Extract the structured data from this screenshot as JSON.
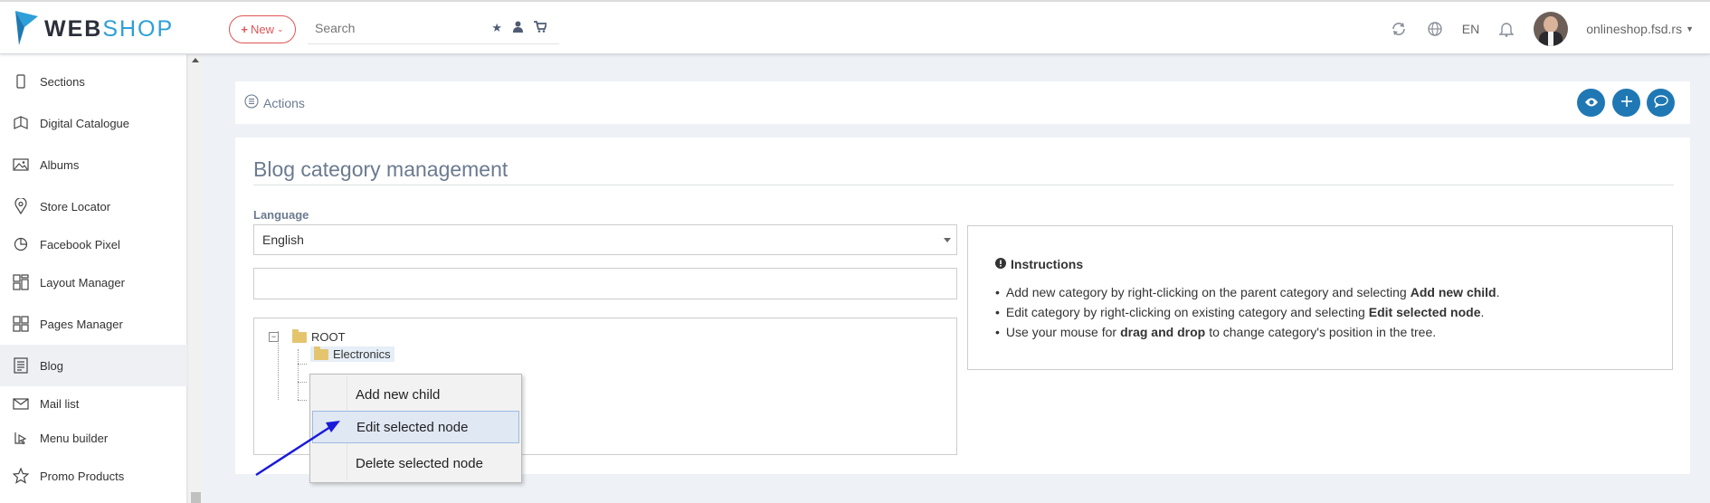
{
  "header": {
    "logo_web": "WEB",
    "logo_shop": "SHOP",
    "new_label": "New",
    "search_placeholder": "Search",
    "lang": "EN",
    "site": "onlineshop.fsd.rs"
  },
  "sidebar": {
    "items": [
      {
        "label": "Sections",
        "icon": "tablet-icon"
      },
      {
        "label": "Digital Catalogue",
        "icon": "catalogue-icon"
      },
      {
        "label": "Albums",
        "icon": "image-icon"
      },
      {
        "label": "Store Locator",
        "icon": "location-icon"
      },
      {
        "label": "Facebook Pixel",
        "icon": "pie-chart-icon"
      },
      {
        "label": "Layout Manager",
        "icon": "layout-icon"
      },
      {
        "label": "Pages Manager",
        "icon": "pages-icon"
      },
      {
        "label": "Blog",
        "icon": "blog-icon"
      },
      {
        "label": "Mail list",
        "icon": "mail-icon"
      },
      {
        "label": "Menu builder",
        "icon": "menu-builder-icon"
      },
      {
        "label": "Promo Products",
        "icon": "star-icon"
      }
    ],
    "active": "Blog"
  },
  "actions": {
    "label": "Actions"
  },
  "panel": {
    "title": "Blog category management",
    "language_label": "Language",
    "language_value": "English",
    "tree": {
      "root": "ROOT",
      "child": "Electronics"
    },
    "instructions": {
      "title": "Instructions",
      "items": [
        {
          "pre": "Add new category by right-clicking on the parent category and selecting",
          "bold": "Add new child",
          "post": "."
        },
        {
          "pre": "Edit category by right-clicking on existing category and selecting",
          "bold": "Edit selected node",
          "post": "."
        },
        {
          "pre": "Use your mouse for",
          "bold": "drag and drop",
          "post": "to change category's position in the tree."
        }
      ]
    }
  },
  "context_menu": {
    "items": [
      "Add new child",
      "Edit selected node",
      "Delete selected node"
    ]
  },
  "colors": {
    "accent": "#1f78b4",
    "new_button": "#e05555",
    "logo_shop": "#2d9fd9",
    "title": "#6b7b8f",
    "arrow": "#1a1adb"
  }
}
